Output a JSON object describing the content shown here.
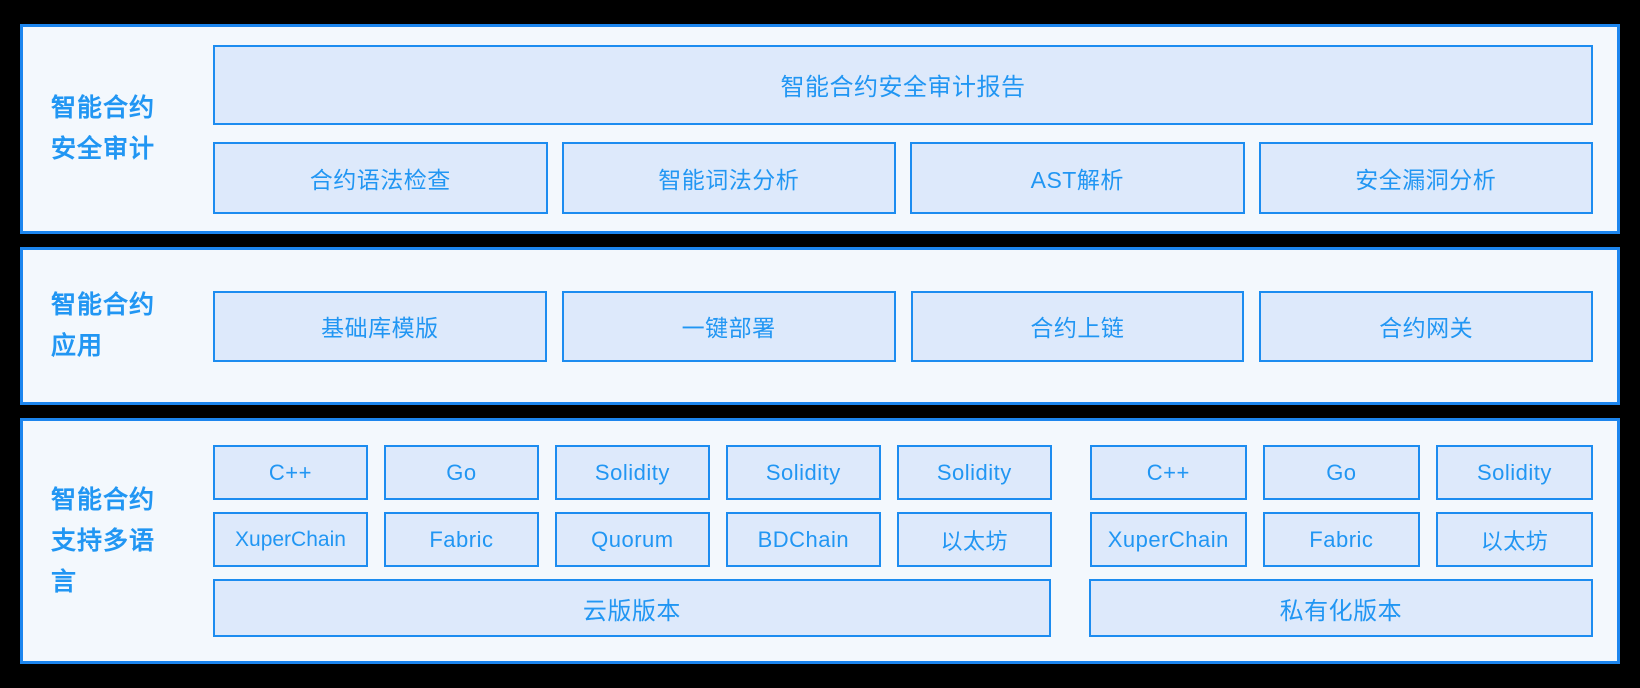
{
  "colors": {
    "background": "#000000",
    "panel_fill": "#f3f8fd",
    "panel_border": "#1c85ee",
    "cell_fill": "#dde9fb",
    "cell_border": "#1c8cf0",
    "text_blue": "#2196f3"
  },
  "sections": [
    {
      "id": "smart-contract-security-audit",
      "title": "智能合约\n安全审计",
      "title_line1": "智能合约",
      "title_line2": "安全审计",
      "report": "智能合约安全审计报告",
      "items": [
        "合约语法检查",
        "智能词法分析",
        "AST解析",
        "安全漏洞分析"
      ]
    },
    {
      "id": "smart-contract-application",
      "title_line1": "智能合约",
      "title_line2": "应用",
      "items": [
        "基础库模版",
        "一键部署",
        "合约上链",
        "合约网关"
      ]
    },
    {
      "id": "smart-contract-multi-language",
      "title_line1": "智能合约",
      "title_line2": "支持多语",
      "title_line3": "言",
      "cloud_group": {
        "languages": [
          "C++",
          "Go",
          "Solidity",
          "Solidity",
          "Solidity"
        ],
        "chains": [
          "XuperChain",
          "Fabric",
          "Quorum",
          "BDChain",
          "以太坊"
        ],
        "edition": "云版版本"
      },
      "private_group": {
        "languages": [
          "C++",
          "Go",
          "Solidity"
        ],
        "chains": [
          "XuperChain",
          "Fabric",
          "以太坊"
        ],
        "edition": "私有化版本"
      }
    }
  ]
}
